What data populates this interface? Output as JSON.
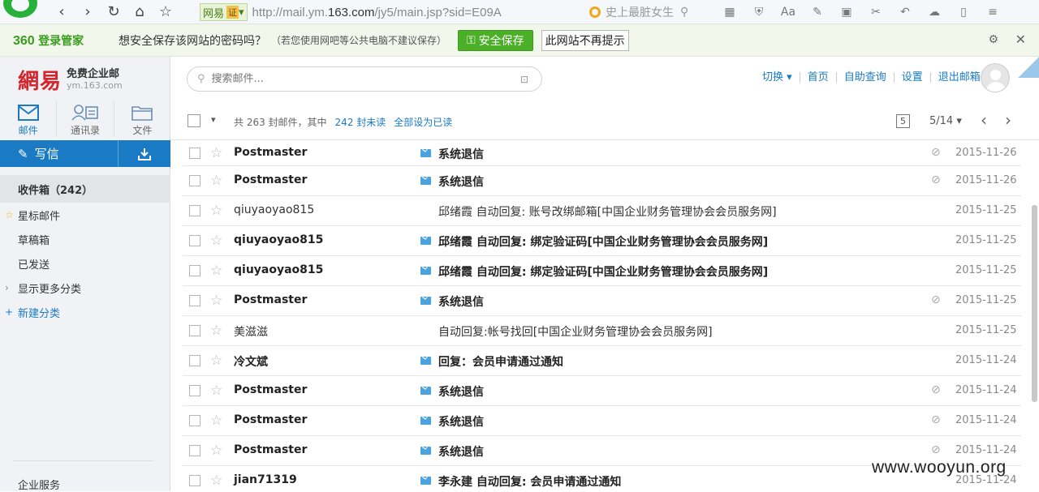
{
  "browser": {
    "label_tag": "网易",
    "cert_tag": "证",
    "url_prefix": "http://mail.ym.",
    "url_domain": "163.com",
    "url_rest": "/jy5/main.jsp?sid=E09A",
    "search_text": "史上最脏女生"
  },
  "password_bar": {
    "brand": "360",
    "brand_suffix": "登录管家",
    "message": "想安全保存该网站的密码吗？",
    "note": "（若您使用网吧等公共电脑不建议保存）",
    "save_label": "安全保存",
    "never_label": "此网站不再提示"
  },
  "sidebar": {
    "logo_cn": "網易",
    "logo_title": "免费企业邮",
    "logo_domain": "ym.163.com",
    "modules": [
      {
        "label": "邮件",
        "icon": "envelope-icon",
        "active": true
      },
      {
        "label": "通讯录",
        "icon": "contacts-icon",
        "active": false
      },
      {
        "label": "文件",
        "icon": "folder-icon",
        "active": false
      }
    ],
    "compose_label": "写信",
    "folders": [
      {
        "label": "收件箱（242）",
        "selected": true
      },
      {
        "label": "星标邮件",
        "prefix": "☆"
      },
      {
        "label": "草稿箱"
      },
      {
        "label": "已发送"
      },
      {
        "label": "显示更多分类",
        "prefix": "›"
      },
      {
        "label": "新建分类",
        "prefix": "+"
      }
    ],
    "enterprise_label": "企业服务"
  },
  "topbar": {
    "search_placeholder": "搜索邮件...",
    "links": [
      "切换",
      "首页",
      "自助查询",
      "设置",
      "退出邮箱"
    ]
  },
  "toolbar": {
    "count_text": "共 263 封邮件，其中",
    "unread_text": "242 封未读",
    "mark_all_label": "全部设为已读",
    "page_icon_text": "5",
    "pager_text": "5/14"
  },
  "emails": [
    {
      "sender": "Postmaster",
      "subject": "系统退信",
      "date": "2015-11-26",
      "unread": true,
      "attachment": true
    },
    {
      "sender": "Postmaster",
      "subject": "系统退信",
      "date": "2015-11-26",
      "unread": true,
      "attachment": true
    },
    {
      "sender": "qiuyaoyao815",
      "subject": "邱绪霞 自动回复: 账号改绑邮箱[中国企业财务管理协会会员服务网]",
      "date": "2015-11-25",
      "unread": false,
      "attachment": false
    },
    {
      "sender": "qiuyaoyao815",
      "subject": "邱绪霞 自动回复: 绑定验证码[中国企业财务管理协会会员服务网]",
      "date": "2015-11-25",
      "unread": true,
      "attachment": false
    },
    {
      "sender": "qiuyaoyao815",
      "subject": "邱绪霞 自动回复: 绑定验证码[中国企业财务管理协会会员服务网]",
      "date": "2015-11-25",
      "unread": true,
      "attachment": false
    },
    {
      "sender": "Postmaster",
      "subject": "系统退信",
      "date": "2015-11-25",
      "unread": true,
      "attachment": true
    },
    {
      "sender": "美滋滋",
      "subject": "自动回复:帐号找回[中国企业财务管理协会会员服务网]",
      "date": "2015-11-25",
      "unread": false,
      "attachment": false
    },
    {
      "sender": "冷文斌",
      "subject": "回复：会员申请通过通知",
      "date": "2015-11-24",
      "unread": true,
      "attachment": false
    },
    {
      "sender": "Postmaster",
      "subject": "系统退信",
      "date": "2015-11-24",
      "unread": true,
      "attachment": true
    },
    {
      "sender": "Postmaster",
      "subject": "系统退信",
      "date": "2015-11-24",
      "unread": true,
      "attachment": true
    },
    {
      "sender": "Postmaster",
      "subject": "系统退信",
      "date": "2015-11-24",
      "unread": true,
      "attachment": true
    },
    {
      "sender": "jian71319",
      "subject": "李永建 自动回复: 会员申请通过通知",
      "date": "2015-11-24",
      "unread": true,
      "attachment": false
    }
  ],
  "watermark": "www.wooyun.org"
}
